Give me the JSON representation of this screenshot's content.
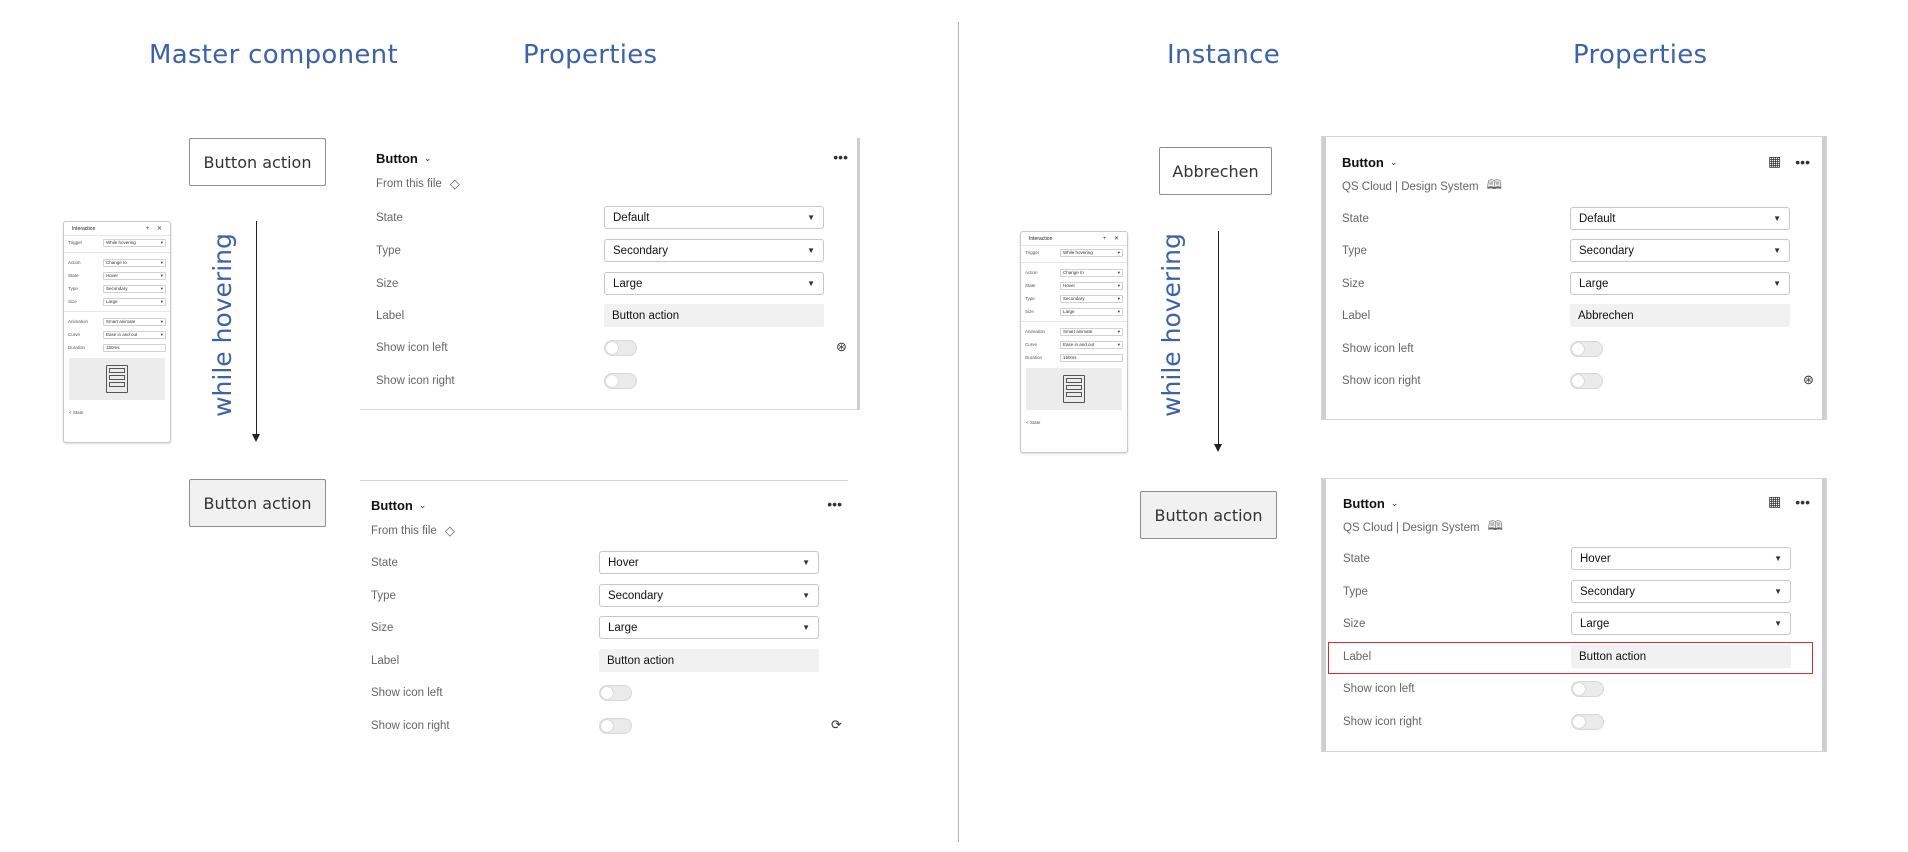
{
  "headings": {
    "master_component": "Master component",
    "properties_left": "Properties",
    "instance": "Instance",
    "properties_right": "Properties"
  },
  "master": {
    "button_default_label": "Button action",
    "button_hover_label": "Button action",
    "transition_label": "while hovering"
  },
  "instance": {
    "button_default_label": "Abbrechen",
    "button_hover_label": "Button action",
    "transition_label": "while hovering"
  },
  "thumbnail": {
    "title": "Interaction",
    "rows": [
      {
        "key": "Trigger",
        "value": "While hovering"
      },
      {
        "key": "Action",
        "value": "Change to"
      },
      {
        "key": "State",
        "value": "Hover"
      },
      {
        "key": "Type",
        "value": "Secondary"
      },
      {
        "key": "Size",
        "value": "Large"
      }
    ],
    "rows2": [
      {
        "key": "Animation",
        "value": "Smart animate"
      },
      {
        "key": "Curve",
        "value": "Ease in and out"
      },
      {
        "key": "Duration",
        "value": "150ms"
      }
    ],
    "footer": "< State"
  },
  "labels": {
    "state": "State",
    "type": "Type",
    "size": "Size",
    "label": "Label",
    "show_icon_left": "Show icon left",
    "show_icon_right": "Show icon right"
  },
  "panels": {
    "master_default": {
      "component": "Button",
      "source": "From this file",
      "state": "Default",
      "type": "Secondary",
      "size": "Large",
      "label": "Button action",
      "show_icon_left": false,
      "show_icon_right": false
    },
    "master_hover": {
      "component": "Button",
      "source": "From this file",
      "state": "Hover",
      "type": "Secondary",
      "size": "Large",
      "label": "Button action",
      "show_icon_left": false,
      "show_icon_right": false
    },
    "instance_default": {
      "component": "Button",
      "source": "QS Cloud | Design System",
      "state": "Default",
      "type": "Secondary",
      "size": "Large",
      "label": "Abbrechen",
      "show_icon_left": false,
      "show_icon_right": false
    },
    "instance_hover": {
      "component": "Button",
      "source": "QS Cloud | Design System",
      "state": "Hover",
      "type": "Secondary",
      "size": "Large",
      "label": "Button action",
      "show_icon_left": false,
      "show_icon_right": false
    }
  },
  "icons": {
    "chevron": "chevron-down-icon",
    "component": "diamond-icon",
    "library": "book-icon",
    "more": "ellipsis-icon",
    "instance": "grid-icon",
    "swap": "swap-icon"
  },
  "colors": {
    "heading": "#3d63a6",
    "highlight": "#d62a35",
    "divider": "#b5b5b5"
  }
}
